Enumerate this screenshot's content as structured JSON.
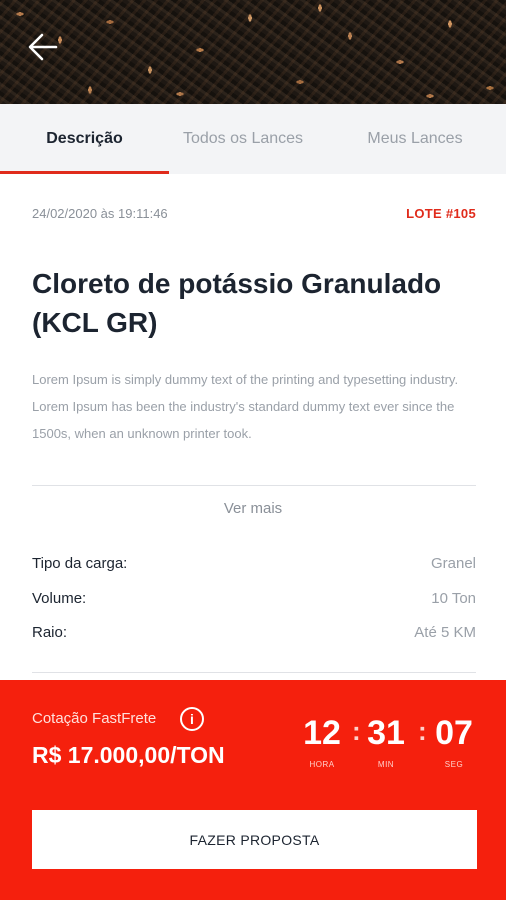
{
  "header": {
    "back_icon": "arrow-left-icon"
  },
  "tabs": [
    {
      "label": "Descrição",
      "active": true
    },
    {
      "label": "Todos os Lances",
      "active": false
    },
    {
      "label": "Meus Lances",
      "active": false
    }
  ],
  "lot": {
    "datetime": "24/02/2020 às 19:11:46",
    "lot_number": "LOTE #105",
    "title": "Cloreto de potássio Granulado (KCL GR)",
    "description": "Lorem Ipsum is simply dummy text of the printing and typesetting industry. Lorem Ipsum has been the industry's standard dummy text ever since the 1500s, when an unknown printer took.",
    "more_label": "Ver mais",
    "details": [
      {
        "label": "Tipo da carga:",
        "value": "Granel"
      },
      {
        "label": "Volume:",
        "value": "10 Ton"
      },
      {
        "label": "Raio:",
        "value": "Até 5 KM"
      }
    ]
  },
  "footer": {
    "quote_label": "Cotação FastFrete",
    "info_icon": "info-icon",
    "price": "R$ 17.000,00/TON",
    "timer": {
      "hours": "12",
      "hours_label": "HORA",
      "minutes": "31",
      "minutes_label": "MIN",
      "seconds": "07",
      "seconds_label": "SEG",
      "separator": ":"
    },
    "cta_label": "FAZER PROPOSTA"
  },
  "colors": {
    "accent": "#f5200d",
    "lot_red": "#e02b1b"
  }
}
